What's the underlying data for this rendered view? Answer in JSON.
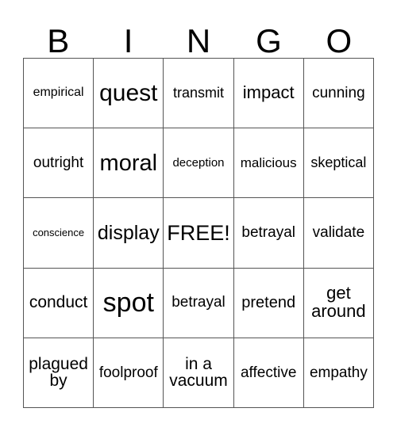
{
  "card": {
    "title": "BINGO",
    "header_letters": [
      "B",
      "I",
      "N",
      "G",
      "O"
    ],
    "columns": 5,
    "rows": 5,
    "free_space_label": "FREE!",
    "free_space_position": "2,2",
    "colors": {
      "background": "#ffffff",
      "text": "#000000",
      "grid_line": "#555555"
    },
    "cells": [
      [
        {
          "text": "empirical",
          "font_size": 16,
          "lines": 1
        },
        {
          "text": "quest",
          "font_size": 30,
          "lines": 1
        },
        {
          "text": "transmit",
          "font_size": 18,
          "lines": 1
        },
        {
          "text": "impact",
          "font_size": 22,
          "lines": 1
        },
        {
          "text": "cunning",
          "font_size": 19,
          "lines": 1
        }
      ],
      [
        {
          "text": "outright",
          "font_size": 19,
          "lines": 1
        },
        {
          "text": "moral",
          "font_size": 29,
          "lines": 1
        },
        {
          "text": "deception",
          "font_size": 15,
          "lines": 1
        },
        {
          "text": "malicious",
          "font_size": 17,
          "lines": 1
        },
        {
          "text": "skeptical",
          "font_size": 18,
          "lines": 1
        }
      ],
      [
        {
          "text": "conscience",
          "font_size": 13,
          "lines": 1
        },
        {
          "text": "display",
          "font_size": 25,
          "lines": 1
        },
        {
          "text": "FREE!",
          "font_size": 27,
          "lines": 1
        },
        {
          "text": "betrayal",
          "font_size": 19,
          "lines": 1
        },
        {
          "text": "validate",
          "font_size": 19,
          "lines": 1
        }
      ],
      [
        {
          "text": "conduct",
          "font_size": 21,
          "lines": 1
        },
        {
          "text": "spot",
          "font_size": 34,
          "lines": 1
        },
        {
          "text": "betrayal",
          "font_size": 19,
          "lines": 1
        },
        {
          "text": "pretend",
          "font_size": 20,
          "lines": 1
        },
        {
          "text": "get\naround",
          "font_size": 22,
          "lines": 2
        }
      ],
      [
        {
          "text": "plagued\nby",
          "font_size": 21,
          "lines": 2
        },
        {
          "text": "foolproof",
          "font_size": 19,
          "lines": 1
        },
        {
          "text": "in a\nvacuum",
          "font_size": 21,
          "lines": 2
        },
        {
          "text": "affective",
          "font_size": 19,
          "lines": 1
        },
        {
          "text": "empathy",
          "font_size": 19,
          "lines": 1
        }
      ]
    ]
  }
}
